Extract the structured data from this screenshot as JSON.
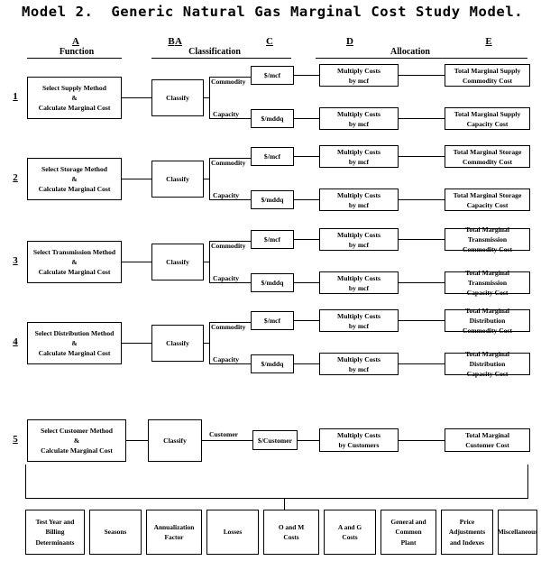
{
  "title": "Model 2.  Generic Natural Gas Marginal Cost Study Model.",
  "columns": [
    {
      "letter": "A",
      "name": "Function"
    },
    {
      "letter": "B",
      "name": "Classification"
    },
    {
      "letter": "C",
      "name": ""
    },
    {
      "letter": "D",
      "name": "Allocation"
    },
    {
      "letter": "E",
      "name": ""
    }
  ],
  "column_groups": [
    {
      "name": "Function"
    },
    {
      "name": "Classification"
    },
    {
      "name": "Allocation"
    }
  ],
  "rows": [
    {
      "number": "1",
      "function": "Select Supply Method\n&\nCalculate Marginal Cost",
      "classify": "Classify",
      "branches": [
        {
          "label": "Commodity",
          "unit": "$/mcf",
          "allocation": "Multiply Costs\nby mcf",
          "total": "Total Marginal Supply\nCommodity Cost"
        },
        {
          "label": "Capacity",
          "unit": "$/mddq",
          "allocation": "Multiply Costs\nby mcf",
          "total": "Total Marginal Supply\nCapacity Cost"
        }
      ]
    },
    {
      "number": "2",
      "function": "Select Storage Method\n&\nCalculate Marginal Cost",
      "classify": "Classify",
      "branches": [
        {
          "label": "Commodity",
          "unit": "$/mcf",
          "allocation": "Multiply Costs\nby mcf",
          "total": "Total Marginal Storage\nCommodity Cost"
        },
        {
          "label": "Capacity",
          "unit": "$/mddq",
          "allocation": "Multiply Costs\nby mcf",
          "total": "Total Marginal Storage\nCapacity Cost"
        }
      ]
    },
    {
      "number": "3",
      "function": "Select Transmission Method\n&\nCalculate Marginal Cost",
      "classify": "Classify",
      "branches": [
        {
          "label": "Commodity",
          "unit": "$/mcf",
          "allocation": "Multiply Costs\nby mcf",
          "total": "Total Marginal Transmission\nCommodity Cost"
        },
        {
          "label": "Capacity",
          "unit": "$/mddq",
          "allocation": "Multiply Costs\nby mcf",
          "total": "Total Marginal Transmission\nCapacity Cost"
        }
      ]
    },
    {
      "number": "4",
      "function": "Select Distribution Method\n&\nCalculate Marginal Cost",
      "classify": "Classify",
      "branches": [
        {
          "label": "Commodity",
          "unit": "$/mcf",
          "allocation": "Multiply Costs\nby mcf",
          "total": "Total Marginal Distribution\nCommodity Cost"
        },
        {
          "label": "Capacity",
          "unit": "$/mddq",
          "allocation": "Multiply Costs\nby mcf",
          "total": "Total Marginal Distribution\nCapacity Cost"
        }
      ]
    },
    {
      "number": "5",
      "function": "Select Customer Method\n&\nCalculate Marginal Cost",
      "classify": "Classify",
      "branches": [
        {
          "label": "Customer",
          "unit": "$/Customer",
          "allocation": "Multiply Costs\nby Customers",
          "total": "Total Marginal\nCustomer Cost"
        }
      ]
    }
  ],
  "footer_boxes": [
    "Test Year and\nBilling\nDeterminants",
    "Seasons",
    "Annualization\nFactor",
    "Losses",
    "O and M\nCosts",
    "A and G\nCosts",
    "General and\nCommon\nPlant",
    "Price\nAdjustments\nand Indexes",
    "Miscellaneous"
  ],
  "colors": {
    "ink": "#000000",
    "paper": "#ffffff"
  }
}
